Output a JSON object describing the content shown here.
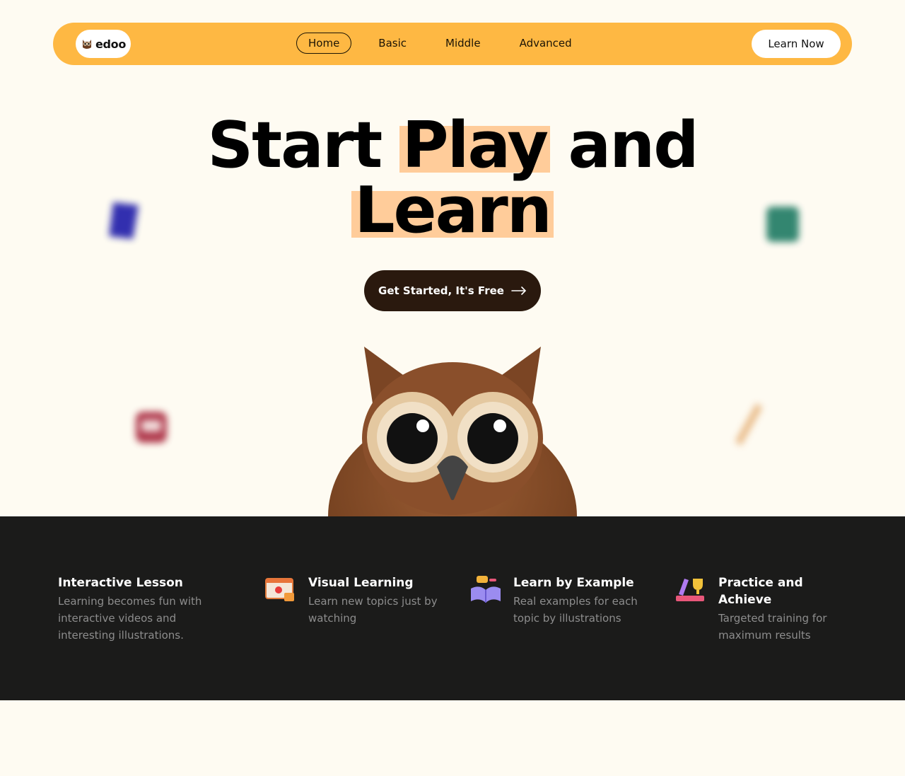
{
  "nav": {
    "logo_text": "edoo",
    "menu": [
      {
        "label": "Home",
        "active": true
      },
      {
        "label": "Basic",
        "active": false
      },
      {
        "label": "Middle",
        "active": false
      },
      {
        "label": "Advanced",
        "active": false
      }
    ],
    "cta_label": "Learn Now"
  },
  "hero": {
    "title_word1": "Start",
    "title_word2": "Play",
    "title_word3": "and",
    "title_word4": "Learn",
    "button_label": "Get Started, It's Free",
    "highlight_color": "#ffcc9a"
  },
  "features": [
    {
      "title": "Interactive Lesson",
      "description": "Learning becomes fun with interactive videos and interesting illustrations.",
      "icon": "none"
    },
    {
      "title": "Visual Learning",
      "description": "Learn new topics just by watching",
      "icon": "video-lesson-icon"
    },
    {
      "title": "Learn by Example",
      "description": "Real examples for each topic by illustrations",
      "icon": "open-book-icon"
    },
    {
      "title": "Practice and Achieve",
      "description": "Targeted training for maximum results",
      "icon": "trophy-books-icon"
    }
  ],
  "colors": {
    "page_bg": "#fefbf2",
    "nav_bg": "#feb843",
    "button_dark": "#2a190e",
    "features_bg": "#1b1b1a"
  }
}
